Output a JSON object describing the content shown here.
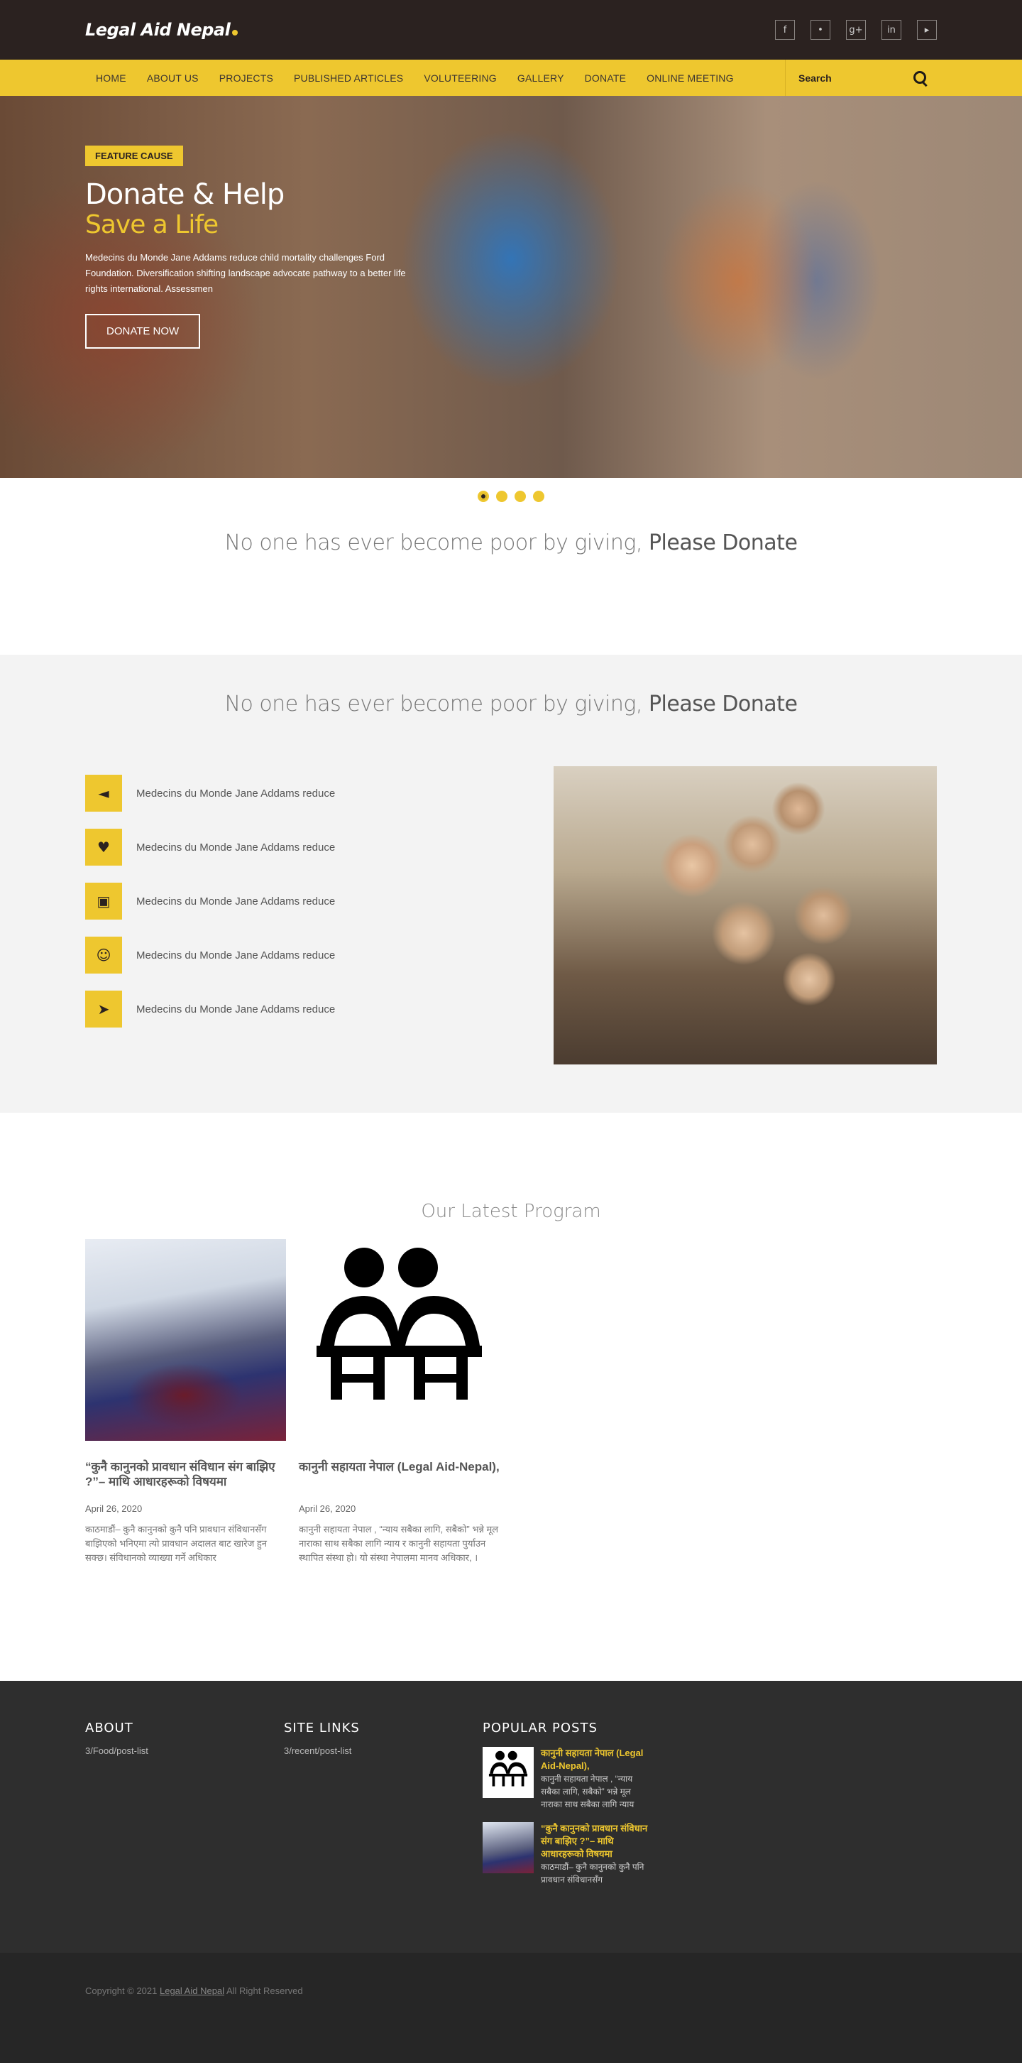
{
  "header": {
    "logo": "Legal Aid Nepal",
    "social": [
      {
        "icon": "facebook-icon",
        "glyph": "f"
      },
      {
        "icon": "twitter-icon",
        "glyph": "•"
      },
      {
        "icon": "google-plus-icon",
        "glyph": "g+"
      },
      {
        "icon": "linkedin-icon",
        "glyph": "in"
      },
      {
        "icon": "youtube-icon",
        "glyph": "▸"
      }
    ]
  },
  "nav": {
    "items": [
      "HOME",
      "ABOUT US",
      "PROJECTS",
      "PUBLISHED ARTICLES",
      "VOLUTEERING",
      "GALLERY",
      "DONATE",
      "ONLINE MEETING"
    ],
    "search_placeholder": "Search"
  },
  "hero": {
    "badge": "FEATURE CAUSE",
    "title": "Donate & Help",
    "subtitle": "Save a Life",
    "text": "Medecins du Monde Jane Addams reduce child mortality challenges Ford Foundation. Diversification shifting landscape advocate pathway to a better life rights international. Assessmen",
    "button": "DONATE NOW",
    "slides": 4,
    "active_slide": 1
  },
  "tagline": {
    "light": "No one has ever become poor by giving,",
    "bold": "Please Donate"
  },
  "features": {
    "tagline_light": "No one has ever become poor by giving,",
    "tagline_bold": "Please Donate",
    "items": [
      {
        "icon": "megaphone-icon",
        "glyph": "◄",
        "label": "Medecins du Monde Jane Addams reduce"
      },
      {
        "icon": "heart-pulse-icon",
        "glyph": "♥",
        "label": "Medecins du Monde Jane Addams reduce"
      },
      {
        "icon": "puzzle-icon",
        "glyph": "▣",
        "label": "Medecins du Monde Jane Addams reduce"
      },
      {
        "icon": "smile-icon",
        "glyph": "☺",
        "label": "Medecins du Monde Jane Addams reduce"
      },
      {
        "icon": "paper-plane-icon",
        "glyph": "➤",
        "label": "Medecins du Monde Jane Addams reduce"
      }
    ]
  },
  "program": {
    "title": "Our Latest Program",
    "posts": [
      {
        "title": "“कुनै कानुनको प्रावधान संविधान संग बाझिए ?”– माथि आधारहरूको विषयमा",
        "date": "April 26, 2020",
        "excerpt": "काठमाडौं– कुनै कानुनको कुनै पनि प्रावधान संविधानसँग बाझिएको भनिएमा त्यो प्रावधान अदालत बाट खारेज हुन सक्छ। संविधानको व्याख्या गर्ने अधिकार"
      },
      {
        "title": "कानुनी सहायता नेपाल (Legal Aid-Nepal),",
        "date": "April 26, 2020",
        "excerpt": "कानुनी सहायता नेपाल , “न्याय सबैका लागि, सबैको” भन्ने मूल नाराका साथ सबैका लागि न्याय र कानुनी सहायता पुर्याउन स्थापित संस्था हो। यो संस्था नेपालमा मानव अधिकार, ।"
      }
    ]
  },
  "footer": {
    "about_heading": "ABOUT",
    "about_link": "3/Food/post-list",
    "links_heading": "SITE LINKS",
    "links_link": "3/recent/post-list",
    "popular_heading": "POPULAR POSTS",
    "popular": [
      {
        "title": "कानुनी सहायता नेपाल (Legal Aid-Nepal),",
        "text": "कानुनी सहायता नेपाल , “न्याय सबैका लागि, सबैको” भन्ने मूल नाराका साथ सबैका लागि न्याय"
      },
      {
        "title": "“कुनै कानुनको प्रावधान संविधान संग बाझिए ?”– माथि आधारहरूको विषयमा",
        "text": "काठमाडौं– कुनै कानुनको कुनै पनि प्रावधान संविधानसँग"
      }
    ],
    "copyright_prefix": "Copyright © 2021",
    "copyright_link": "Legal Aid Nepal",
    "copyright_suffix": "All Right Reserved"
  },
  "colors": {
    "accent": "#eec72f",
    "topbar": "#2b2220",
    "footer": "#2e2e2e"
  }
}
